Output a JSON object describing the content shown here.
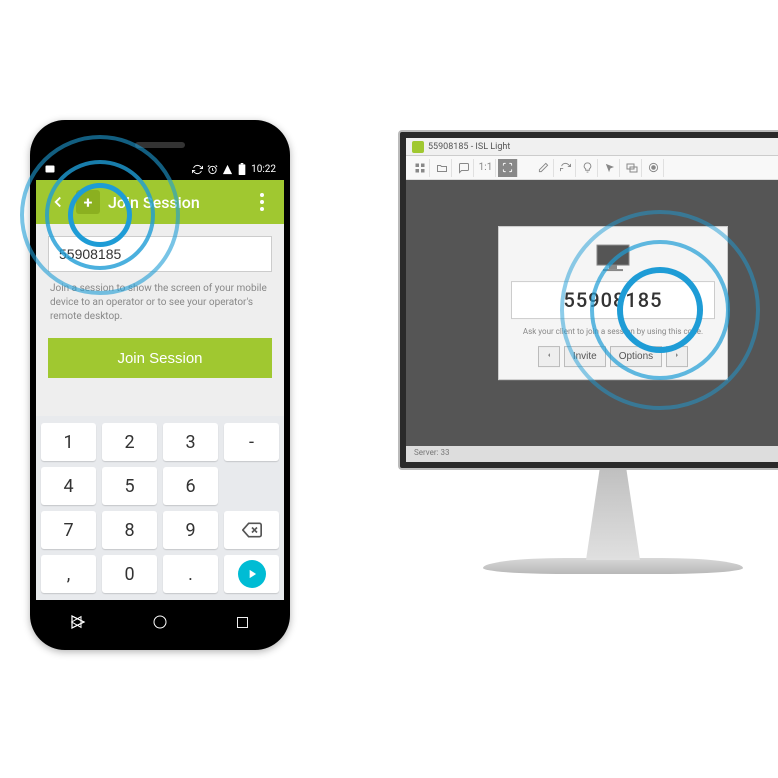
{
  "phone": {
    "status": {
      "time": "10:22"
    },
    "appbar": {
      "title": "Join Session"
    },
    "input": {
      "value": "55908185"
    },
    "helper": "Join a session to show the screen of your mobile device to an operator or to see your operator's remote desktop.",
    "joinBtn": "Join Session",
    "keypad": {
      "r1": [
        "1",
        "2",
        "3",
        "-"
      ],
      "r2": [
        "4",
        "5",
        "6",
        ""
      ],
      "r3": [
        "7",
        "8",
        "9",
        "⌫"
      ],
      "r4": [
        ",",
        "0",
        ".",
        "▶"
      ]
    }
  },
  "desktop": {
    "windowTitle": "55908185 - ISL Light",
    "toolbar": {
      "ratio": "1:1"
    },
    "panel": {
      "code": "55908185",
      "hint": "Ask your client to join a session by using this code.",
      "inviteBtn": "Invite",
      "optionsBtn": "Options"
    },
    "statusLine": "Server: 33"
  }
}
